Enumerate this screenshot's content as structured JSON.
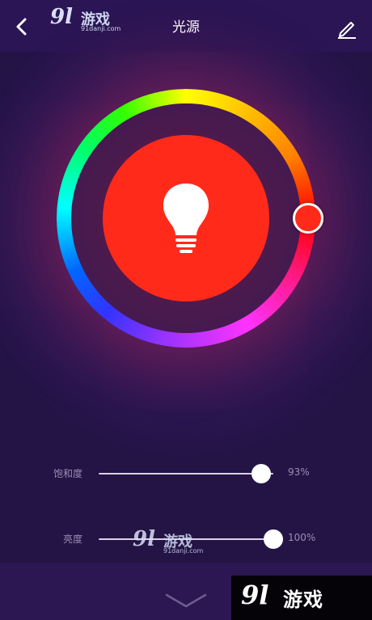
{
  "header": {
    "title": "光源",
    "back_icon": "chevron-left-icon",
    "edit_icon": "pencil-icon"
  },
  "color_picker": {
    "selected_color": "#ff2a1a",
    "bulb_icon": "lightbulb-icon"
  },
  "sliders": [
    {
      "label": "饱和度",
      "value_text": "93%",
      "value": 0.93
    },
    {
      "label": "亮度",
      "value_text": "100%",
      "value": 1.0
    }
  ],
  "footer": {
    "collapse_icon": "chevron-down-icon"
  },
  "watermark": {
    "brand_num": "9l",
    "brand_name": "游戏",
    "url": "91danji.com"
  }
}
